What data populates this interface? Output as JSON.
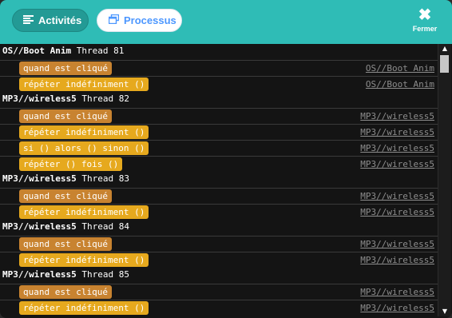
{
  "header": {
    "tabs": [
      {
        "label": "Activités",
        "icon": "list-icon",
        "active": false
      },
      {
        "label": "Processus",
        "icon": "windows-icon",
        "active": true
      }
    ],
    "close": {
      "symbol": "✖",
      "label": "Fermer"
    }
  },
  "threads": [
    {
      "name": "OS//Boot Anim",
      "suffix": "Thread 81",
      "blocks": [
        {
          "label": "quand est cliqué",
          "category": "event",
          "target": "OS//Boot Anim"
        },
        {
          "label": "répéter indéfiniment ()",
          "category": "control",
          "target": "OS//Boot Anim"
        }
      ]
    },
    {
      "name": "MP3//wireless5",
      "suffix": "Thread 82",
      "blocks": [
        {
          "label": "quand est cliqué",
          "category": "event",
          "target": "MP3//wireless5"
        },
        {
          "label": "répéter indéfiniment ()",
          "category": "control",
          "target": "MP3//wireless5"
        },
        {
          "label": "si () alors () sinon ()",
          "category": "control",
          "target": "MP3//wireless5"
        },
        {
          "label": "répéter () fois ()",
          "category": "control",
          "target": "MP3//wireless5"
        }
      ]
    },
    {
      "name": "MP3//wireless5",
      "suffix": "Thread 83",
      "blocks": [
        {
          "label": "quand est cliqué",
          "category": "event",
          "target": "MP3//wireless5"
        },
        {
          "label": "répéter indéfiniment ()",
          "category": "control",
          "target": "MP3//wireless5"
        }
      ]
    },
    {
      "name": "MP3//wireless5",
      "suffix": "Thread 84",
      "blocks": [
        {
          "label": "quand est cliqué",
          "category": "event",
          "target": "MP3//wireless5"
        },
        {
          "label": "répéter indéfiniment ()",
          "category": "control",
          "target": "MP3//wireless5"
        }
      ]
    },
    {
      "name": "MP3//wireless5",
      "suffix": "Thread 85",
      "blocks": [
        {
          "label": "quand est cliqué",
          "category": "event",
          "target": "MP3//wireless5"
        },
        {
          "label": "répéter indéfiniment ()",
          "category": "control",
          "target": "MP3//wireless5"
        }
      ]
    }
  ],
  "colors": {
    "header": "#2fbcb6",
    "event_block": "#c88330",
    "control_block": "#e6a91e",
    "background": "#141414",
    "link": "#8d8d8d"
  }
}
